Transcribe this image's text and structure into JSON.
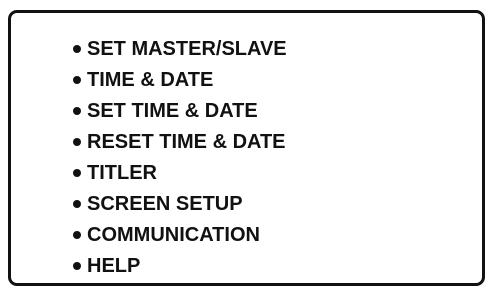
{
  "menu": {
    "items": [
      {
        "label": "SET MASTER/SLAVE"
      },
      {
        "label": "TIME & DATE"
      },
      {
        "label": "SET TIME & DATE"
      },
      {
        "label": "RESET TIME & DATE"
      },
      {
        "label": "TITLER"
      },
      {
        "label": "SCREEN SETUP"
      },
      {
        "label": "COMMUNICATION"
      },
      {
        "label": "HELP"
      }
    ],
    "bullet_icon": "bullet-dot",
    "text_color": "#111111",
    "border_color": "#111111",
    "background_color": "#ffffff"
  }
}
